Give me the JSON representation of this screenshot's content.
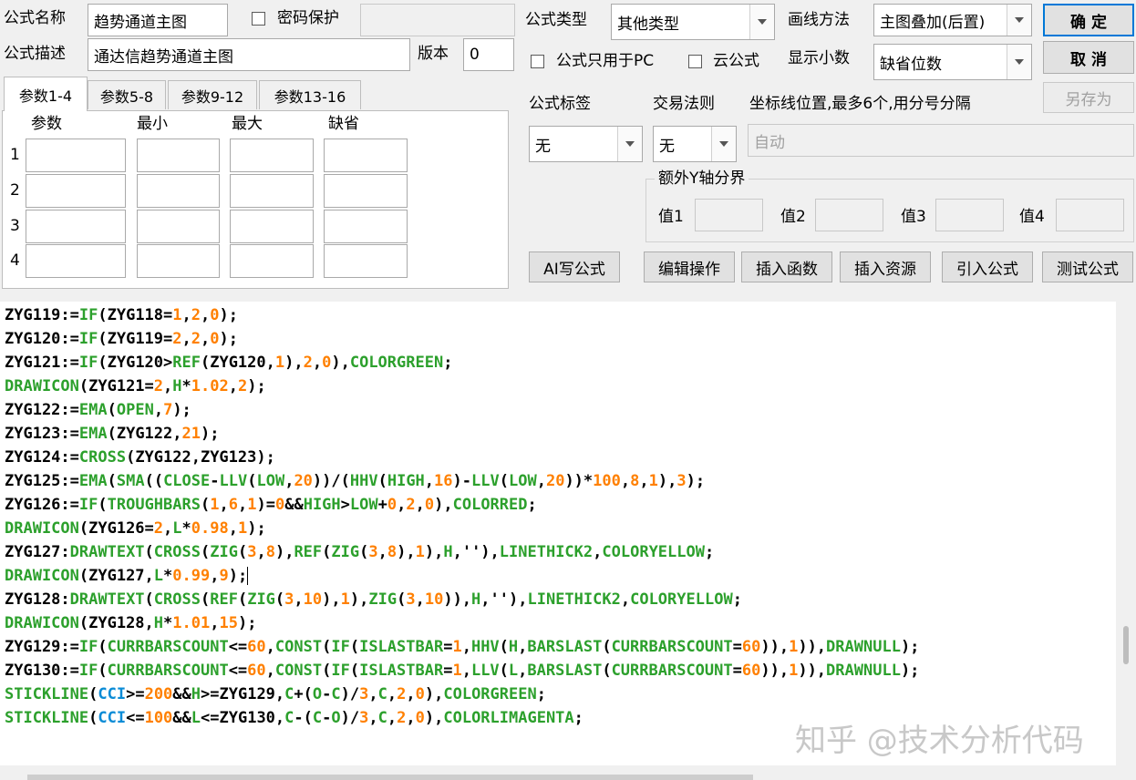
{
  "top": {
    "name_label": "公式名称",
    "name_value": "趋势通道主图",
    "password_label": "密码保护",
    "desc_label": "公式描述",
    "desc_value": "通达信趋势通道主图",
    "version_label": "版本",
    "version_value": "0",
    "type_label": "公式类型",
    "type_value": "其他类型",
    "draw_label": "画线方法",
    "draw_value": "主图叠加(后置)",
    "ok_button": "确  定",
    "pc_only_label": "公式只用于PC",
    "cloud_label": "云公式",
    "decimal_label": "显示小数",
    "decimal_value": "缺省位数",
    "cancel_button": "取  消",
    "saveas_button": "另存为"
  },
  "params": {
    "tabs": [
      "参数1-4",
      "参数5-8",
      "参数9-12",
      "参数13-16"
    ],
    "headers": [
      "参数",
      "最小",
      "最大",
      "缺省"
    ],
    "rows": [
      "1",
      "2",
      "3",
      "4"
    ]
  },
  "right": {
    "tag_label": "公式标签",
    "tag_value": "无",
    "rule_label": "交易法则",
    "rule_value": "无",
    "coord_label": "坐标线位置,最多6个,用分号分隔",
    "coord_placeholder": "自动",
    "yaxis_group": "额外Y轴分界",
    "v1": "值1",
    "v2": "值2",
    "v3": "值3",
    "v4": "值4"
  },
  "buttons": {
    "ai": "AI写公式",
    "edit": "编辑操作",
    "insert_func": "插入函数",
    "insert_res": "插入资源",
    "import": "引入公式",
    "test": "测试公式"
  },
  "code_lines": [
    [
      [
        "n",
        "ZYG119:="
      ],
      [
        "f",
        "IF"
      ],
      [
        "o",
        "(ZYG118="
      ],
      [
        "u",
        "1"
      ],
      [
        "o",
        ","
      ],
      [
        "u",
        "2"
      ],
      [
        "o",
        ","
      ],
      [
        "u",
        "0"
      ],
      [
        "o",
        ");"
      ]
    ],
    [
      [
        "n",
        "ZYG120:="
      ],
      [
        "f",
        "IF"
      ],
      [
        "o",
        "(ZYG119="
      ],
      [
        "u",
        "2"
      ],
      [
        "o",
        ","
      ],
      [
        "u",
        "2"
      ],
      [
        "o",
        ","
      ],
      [
        "u",
        "0"
      ],
      [
        "o",
        ");"
      ]
    ],
    [
      [
        "n",
        "ZYG121:="
      ],
      [
        "f",
        "IF"
      ],
      [
        "o",
        "(ZYG120>"
      ],
      [
        "f",
        "REF"
      ],
      [
        "o",
        "(ZYG120,"
      ],
      [
        "u",
        "1"
      ],
      [
        "o",
        "),"
      ],
      [
        "u",
        "2"
      ],
      [
        "o",
        ","
      ],
      [
        "u",
        "0"
      ],
      [
        "o",
        "),"
      ],
      [
        "f",
        "COLORGREEN"
      ],
      [
        "o",
        ";"
      ]
    ],
    [
      [
        "f",
        "DRAWICON"
      ],
      [
        "o",
        "(ZYG121="
      ],
      [
        "u",
        "2"
      ],
      [
        "o",
        ","
      ],
      [
        "f",
        "H"
      ],
      [
        "o",
        "*"
      ],
      [
        "u",
        "1.02"
      ],
      [
        "o",
        ","
      ],
      [
        "u",
        "2"
      ],
      [
        "o",
        ");"
      ]
    ],
    [
      [
        "n",
        "ZYG122:="
      ],
      [
        "f",
        "EMA"
      ],
      [
        "o",
        "("
      ],
      [
        "f",
        "OPEN"
      ],
      [
        "o",
        ","
      ],
      [
        "u",
        "7"
      ],
      [
        "o",
        ");"
      ]
    ],
    [
      [
        "n",
        "ZYG123:="
      ],
      [
        "f",
        "EMA"
      ],
      [
        "o",
        "(ZYG122,"
      ],
      [
        "u",
        "21"
      ],
      [
        "o",
        ");"
      ]
    ],
    [
      [
        "n",
        "ZYG124:="
      ],
      [
        "f",
        "CROSS"
      ],
      [
        "o",
        "(ZYG122,ZYG123);"
      ]
    ],
    [
      [
        "n",
        "ZYG125:="
      ],
      [
        "f",
        "EMA"
      ],
      [
        "o",
        "("
      ],
      [
        "f",
        "SMA"
      ],
      [
        "o",
        "(("
      ],
      [
        "f",
        "CLOSE"
      ],
      [
        "o",
        "-"
      ],
      [
        "f",
        "LLV"
      ],
      [
        "o",
        "("
      ],
      [
        "f",
        "LOW"
      ],
      [
        "o",
        ","
      ],
      [
        "u",
        "20"
      ],
      [
        "o",
        "))/("
      ],
      [
        "f",
        "HHV"
      ],
      [
        "o",
        "("
      ],
      [
        "f",
        "HIGH"
      ],
      [
        "o",
        ","
      ],
      [
        "u",
        "16"
      ],
      [
        "o",
        ")-"
      ],
      [
        "f",
        "LLV"
      ],
      [
        "o",
        "("
      ],
      [
        "f",
        "LOW"
      ],
      [
        "o",
        ","
      ],
      [
        "u",
        "20"
      ],
      [
        "o",
        "))*"
      ],
      [
        "u",
        "100"
      ],
      [
        "o",
        ","
      ],
      [
        "u",
        "8"
      ],
      [
        "o",
        ","
      ],
      [
        "u",
        "1"
      ],
      [
        "o",
        "),"
      ],
      [
        "u",
        "3"
      ],
      [
        "o",
        ");"
      ]
    ],
    [
      [
        "n",
        "ZYG126:="
      ],
      [
        "f",
        "IF"
      ],
      [
        "o",
        "("
      ],
      [
        "f",
        "TROUGHBARS"
      ],
      [
        "o",
        "("
      ],
      [
        "u",
        "1"
      ],
      [
        "o",
        ","
      ],
      [
        "u",
        "6"
      ],
      [
        "o",
        ","
      ],
      [
        "u",
        "1"
      ],
      [
        "o",
        ")="
      ],
      [
        "u",
        "0"
      ],
      [
        "o",
        "&&"
      ],
      [
        "f",
        "HIGH"
      ],
      [
        "o",
        ">"
      ],
      [
        "f",
        "LOW"
      ],
      [
        "o",
        "+"
      ],
      [
        "u",
        "0"
      ],
      [
        "o",
        ","
      ],
      [
        "u",
        "2"
      ],
      [
        "o",
        ","
      ],
      [
        "u",
        "0"
      ],
      [
        "o",
        "),"
      ],
      [
        "f",
        "COLORRED"
      ],
      [
        "o",
        ";"
      ]
    ],
    [
      [
        "f",
        "DRAWICON"
      ],
      [
        "o",
        "(ZYG126="
      ],
      [
        "u",
        "2"
      ],
      [
        "o",
        ","
      ],
      [
        "f",
        "L"
      ],
      [
        "o",
        "*"
      ],
      [
        "u",
        "0.98"
      ],
      [
        "o",
        ","
      ],
      [
        "u",
        "1"
      ],
      [
        "o",
        ");"
      ]
    ],
    [
      [
        "n",
        "ZYG127:"
      ],
      [
        "f",
        "DRAWTEXT"
      ],
      [
        "o",
        "("
      ],
      [
        "f",
        "CROSS"
      ],
      [
        "o",
        "("
      ],
      [
        "f",
        "ZIG"
      ],
      [
        "o",
        "("
      ],
      [
        "u",
        "3"
      ],
      [
        "o",
        ","
      ],
      [
        "u",
        "8"
      ],
      [
        "o",
        "),"
      ],
      [
        "f",
        "REF"
      ],
      [
        "o",
        "("
      ],
      [
        "f",
        "ZIG"
      ],
      [
        "o",
        "("
      ],
      [
        "u",
        "3"
      ],
      [
        "o",
        ","
      ],
      [
        "u",
        "8"
      ],
      [
        "o",
        "),"
      ],
      [
        "u",
        "1"
      ],
      [
        "o",
        "),"
      ],
      [
        "f",
        "H"
      ],
      [
        "o",
        ",''),"
      ],
      [
        "f",
        "LINETHICK2"
      ],
      [
        "o",
        ","
      ],
      [
        "f",
        "COLORYELLOW"
      ],
      [
        "o",
        ";"
      ]
    ],
    [
      [
        "f",
        "DRAWICON"
      ],
      [
        "o",
        "(ZYG127,"
      ],
      [
        "f",
        "L"
      ],
      [
        "o",
        "*"
      ],
      [
        "u",
        "0.99"
      ],
      [
        "o",
        ","
      ],
      [
        "u",
        "9"
      ],
      [
        "o",
        ");"
      ],
      [
        "c",
        ""
      ]
    ],
    [
      [
        "n",
        "ZYG128:"
      ],
      [
        "f",
        "DRAWTEXT"
      ],
      [
        "o",
        "("
      ],
      [
        "f",
        "CROSS"
      ],
      [
        "o",
        "("
      ],
      [
        "f",
        "REF"
      ],
      [
        "o",
        "("
      ],
      [
        "f",
        "ZIG"
      ],
      [
        "o",
        "("
      ],
      [
        "u",
        "3"
      ],
      [
        "o",
        ","
      ],
      [
        "u",
        "10"
      ],
      [
        "o",
        "),"
      ],
      [
        "u",
        "1"
      ],
      [
        "o",
        "),"
      ],
      [
        "f",
        "ZIG"
      ],
      [
        "o",
        "("
      ],
      [
        "u",
        "3"
      ],
      [
        "o",
        ","
      ],
      [
        "u",
        "10"
      ],
      [
        "o",
        ")),"
      ],
      [
        "f",
        "H"
      ],
      [
        "o",
        ",''),"
      ],
      [
        "f",
        "LINETHICK2"
      ],
      [
        "o",
        ","
      ],
      [
        "f",
        "COLORYELLOW"
      ],
      [
        "o",
        ";"
      ]
    ],
    [
      [
        "f",
        "DRAWICON"
      ],
      [
        "o",
        "(ZYG128,"
      ],
      [
        "f",
        "H"
      ],
      [
        "o",
        "*"
      ],
      [
        "u",
        "1.01"
      ],
      [
        "o",
        ","
      ],
      [
        "u",
        "15"
      ],
      [
        "o",
        ");"
      ]
    ],
    [
      [
        "n",
        "ZYG129:="
      ],
      [
        "f",
        "IF"
      ],
      [
        "o",
        "("
      ],
      [
        "f",
        "CURRBARSCOUNT"
      ],
      [
        "o",
        "<="
      ],
      [
        "u",
        "60"
      ],
      [
        "o",
        ","
      ],
      [
        "f",
        "CONST"
      ],
      [
        "o",
        "("
      ],
      [
        "f",
        "IF"
      ],
      [
        "o",
        "("
      ],
      [
        "f",
        "ISLASTBAR"
      ],
      [
        "o",
        "="
      ],
      [
        "u",
        "1"
      ],
      [
        "o",
        ","
      ],
      [
        "f",
        "HHV"
      ],
      [
        "o",
        "("
      ],
      [
        "f",
        "H"
      ],
      [
        "o",
        ","
      ],
      [
        "f",
        "BARSLAST"
      ],
      [
        "o",
        "("
      ],
      [
        "f",
        "CURRBARSCOUNT"
      ],
      [
        "o",
        "="
      ],
      [
        "u",
        "60"
      ],
      [
        "o",
        ")),"
      ],
      [
        "u",
        "1"
      ],
      [
        "o",
        ")),"
      ],
      [
        "f",
        "DRAWNULL"
      ],
      [
        "o",
        ");"
      ]
    ],
    [
      [
        "n",
        "ZYG130:="
      ],
      [
        "f",
        "IF"
      ],
      [
        "o",
        "("
      ],
      [
        "f",
        "CURRBARSCOUNT"
      ],
      [
        "o",
        "<="
      ],
      [
        "u",
        "60"
      ],
      [
        "o",
        ","
      ],
      [
        "f",
        "CONST"
      ],
      [
        "o",
        "("
      ],
      [
        "f",
        "IF"
      ],
      [
        "o",
        "("
      ],
      [
        "f",
        "ISLASTBAR"
      ],
      [
        "o",
        "="
      ],
      [
        "u",
        "1"
      ],
      [
        "o",
        ","
      ],
      [
        "f",
        "LLV"
      ],
      [
        "o",
        "("
      ],
      [
        "f",
        "L"
      ],
      [
        "o",
        ","
      ],
      [
        "f",
        "BARSLAST"
      ],
      [
        "o",
        "("
      ],
      [
        "f",
        "CURRBARSCOUNT"
      ],
      [
        "o",
        "="
      ],
      [
        "u",
        "60"
      ],
      [
        "o",
        ")),"
      ],
      [
        "u",
        "1"
      ],
      [
        "o",
        ")),"
      ],
      [
        "f",
        "DRAWNULL"
      ],
      [
        "o",
        ");"
      ]
    ],
    [
      [
        "f",
        "STICKLINE"
      ],
      [
        "o",
        "("
      ],
      [
        "b",
        "CCI"
      ],
      [
        "o",
        ">="
      ],
      [
        "u",
        "200"
      ],
      [
        "o",
        "&&"
      ],
      [
        "f",
        "H"
      ],
      [
        "o",
        ">=ZYG129,"
      ],
      [
        "f",
        "C"
      ],
      [
        "o",
        "+("
      ],
      [
        "f",
        "O"
      ],
      [
        "o",
        "-"
      ],
      [
        "f",
        "C"
      ],
      [
        "o",
        ")/"
      ],
      [
        "u",
        "3"
      ],
      [
        "o",
        ","
      ],
      [
        "f",
        "C"
      ],
      [
        "o",
        ","
      ],
      [
        "u",
        "2"
      ],
      [
        "o",
        ","
      ],
      [
        "u",
        "0"
      ],
      [
        "o",
        "),"
      ],
      [
        "f",
        "COLORGREEN"
      ],
      [
        "o",
        ";"
      ]
    ],
    [
      [
        "f",
        "STICKLINE"
      ],
      [
        "o",
        "("
      ],
      [
        "b",
        "CCI"
      ],
      [
        "o",
        "<="
      ],
      [
        "u",
        "100"
      ],
      [
        "o",
        "&&"
      ],
      [
        "f",
        "L"
      ],
      [
        "o",
        "<=ZYG130,"
      ],
      [
        "f",
        "C"
      ],
      [
        "o",
        "-("
      ],
      [
        "f",
        "C"
      ],
      [
        "o",
        "-"
      ],
      [
        "f",
        "O"
      ],
      [
        "o",
        ")/"
      ],
      [
        "u",
        "3"
      ],
      [
        "o",
        ","
      ],
      [
        "f",
        "C"
      ],
      [
        "o",
        ","
      ],
      [
        "u",
        "2"
      ],
      [
        "o",
        ","
      ],
      [
        "u",
        "0"
      ],
      [
        "o",
        "),"
      ],
      [
        "f",
        "COLORLIMAGENTA"
      ],
      [
        "o",
        ";"
      ]
    ]
  ],
  "watermark": "知乎 @技术分析代码"
}
